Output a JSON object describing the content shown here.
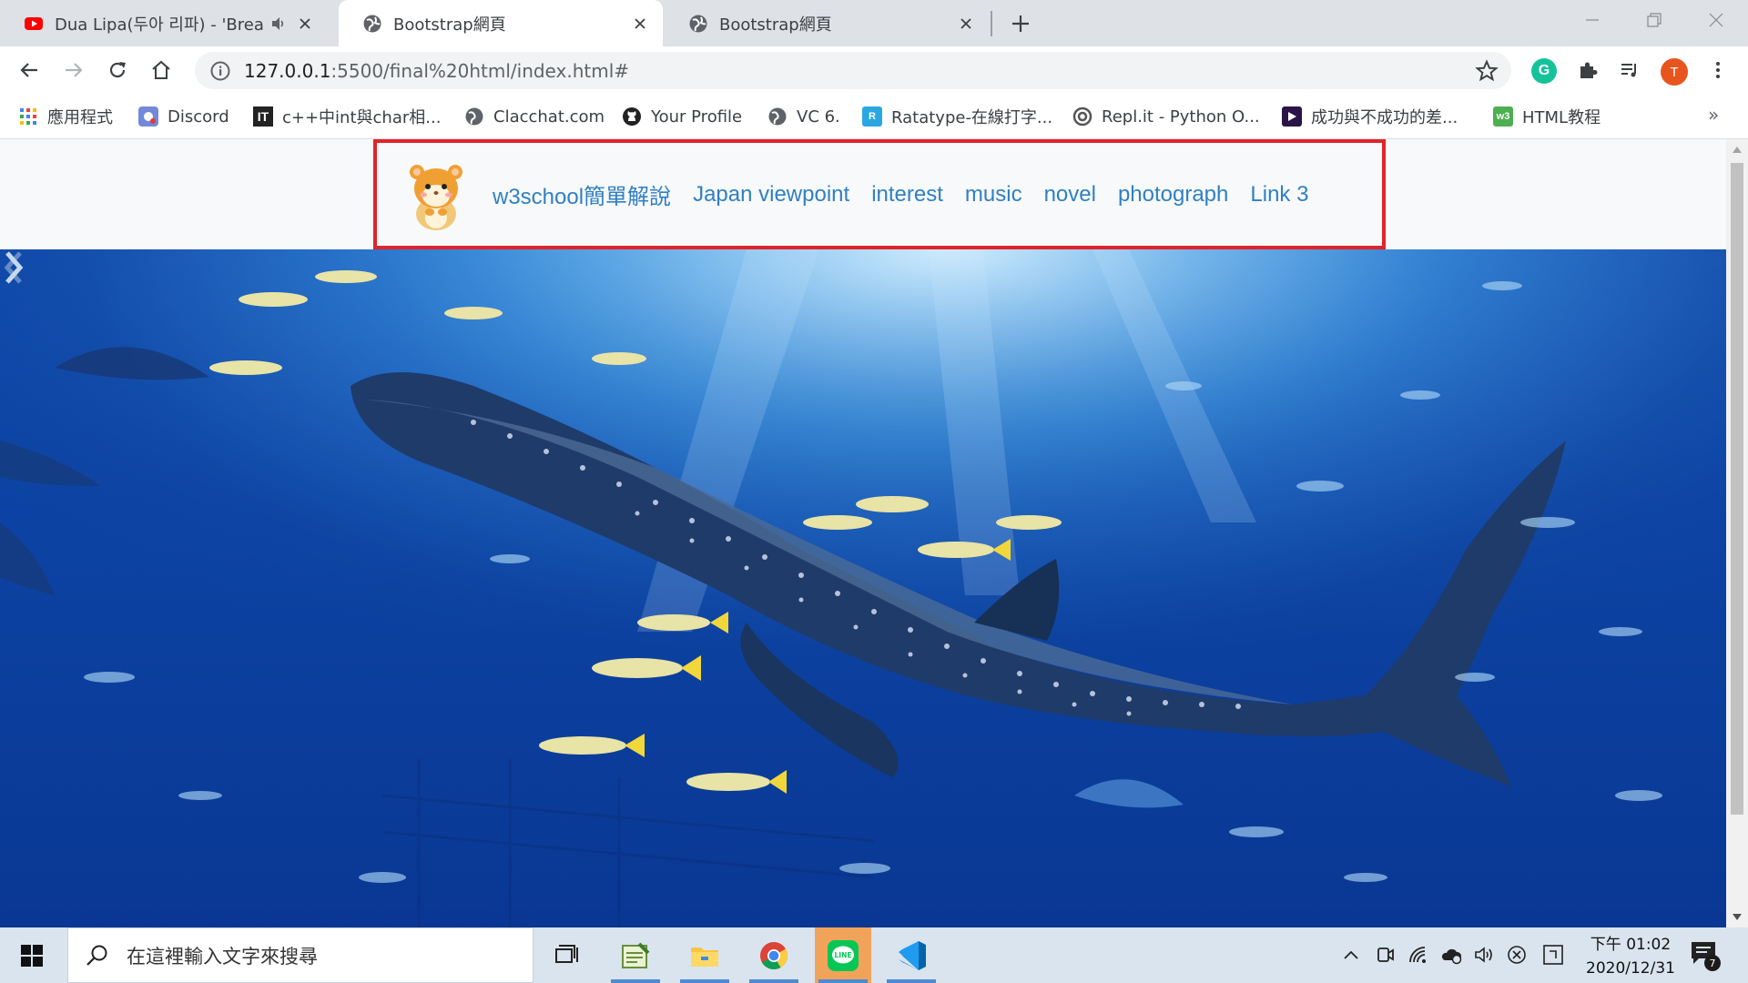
{
  "browser": {
    "tabs": [
      {
        "title": "Dua Lipa(두아 리파) - 'Breal",
        "favicon": "youtube-icon",
        "active": false,
        "audio": true
      },
      {
        "title": "Bootstrap網頁",
        "favicon": "globe-icon",
        "active": true,
        "audio": false
      },
      {
        "title": "Bootstrap網頁",
        "favicon": "globe-icon",
        "active": false,
        "audio": false
      }
    ],
    "url_host": "127.0.0.1",
    "url_rest": ":5500/final%20html/index.html#",
    "profile_initial": "T",
    "grammarly_letter": "G"
  },
  "bookmarks": [
    {
      "label": "應用程式",
      "icon": "apps-grid-icon"
    },
    {
      "label": "Discord",
      "icon": "discord-icon"
    },
    {
      "label": "c++中int與char相...",
      "icon": "ithome-icon",
      "icon_text": "IT"
    },
    {
      "label": "Clacchat.com",
      "icon": "globe-icon"
    },
    {
      "label": "Your Profile",
      "icon": "github-icon"
    },
    {
      "label": "VC 6.",
      "icon": "globe-icon"
    },
    {
      "label": "Ratatype-在線打字...",
      "icon": "ratatype-icon",
      "icon_text": "R"
    },
    {
      "label": "Repl.it - Python O...",
      "icon": "replit-icon"
    },
    {
      "label": "成功與不成功的差...",
      "icon": "video-icon"
    },
    {
      "label": "HTML教程",
      "icon": "w3-icon",
      "icon_text": "w3"
    }
  ],
  "bookmarks_more": "»",
  "page": {
    "nav_links": [
      "w3school簡單解說",
      "Japan viewpoint",
      "interest",
      "music",
      "novel",
      "photograph",
      "Link 3"
    ],
    "brand_logo": "hamster-logo",
    "carousel_next": "chevron-right-icon",
    "carousel_prev": "chevron-left-icon"
  },
  "taskbar": {
    "search_placeholder": "在這裡輸入文字來搜尋",
    "apps": [
      "task-view-icon",
      "notepad-icon",
      "file-explorer-icon",
      "chrome-icon",
      "line-icon",
      "vscode-icon"
    ],
    "time": "下午 01:02",
    "date": "2020/12/31",
    "notification_count": "7"
  },
  "colors": {
    "nav_link": "#2f80c3",
    "highlight_border": "#e0242a",
    "tab_strip": "#dee1e6",
    "taskbar": "#d9e4ef"
  }
}
